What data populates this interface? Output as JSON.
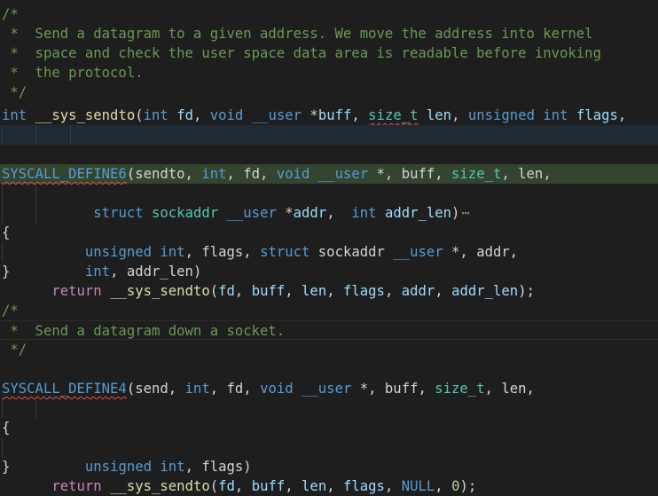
{
  "editor": {
    "language": "C",
    "lines": {
      "l1": [
        {
          "t": "/*",
          "c": "comment"
        }
      ],
      "l2": [
        {
          "t": " *  Send a datagram to a given address. We move the address into kernel",
          "c": "comment"
        }
      ],
      "l3": [
        {
          "t": " *  space and check the user space data area is readable before invoking",
          "c": "comment"
        }
      ],
      "l4": [
        {
          "t": " *  the protocol.",
          "c": "comment"
        }
      ],
      "l5": [
        {
          "t": " */",
          "c": "comment"
        }
      ],
      "l6": [
        {
          "t": "int",
          "c": "kw"
        },
        {
          "t": " ",
          "c": "punc"
        },
        {
          "t": "__sys_sendto",
          "c": "fn"
        },
        {
          "t": "(",
          "c": "punc"
        },
        {
          "t": "int",
          "c": "kw"
        },
        {
          "t": " ",
          "c": "punc"
        },
        {
          "t": "fd",
          "c": "var"
        },
        {
          "t": ", ",
          "c": "punc"
        },
        {
          "t": "void",
          "c": "kw"
        },
        {
          "t": " ",
          "c": "punc"
        },
        {
          "t": "__user",
          "c": "kw"
        },
        {
          "t": " *",
          "c": "punc"
        },
        {
          "t": "buff",
          "c": "var"
        },
        {
          "t": ", ",
          "c": "punc"
        },
        {
          "t": "size_t",
          "c": "type",
          "sq": true
        },
        {
          "t": " ",
          "c": "punc"
        },
        {
          "t": "len",
          "c": "var"
        },
        {
          "t": ", ",
          "c": "punc"
        },
        {
          "t": "unsigned",
          "c": "kw"
        },
        {
          "t": " ",
          "c": "punc"
        },
        {
          "t": "int",
          "c": "kw"
        },
        {
          "t": " ",
          "c": "punc"
        },
        {
          "t": "flags",
          "c": "var"
        },
        {
          "t": ",",
          "c": "punc"
        }
      ],
      "l7": [
        {
          "t": "         ",
          "c": "punc"
        },
        {
          "t": "struct",
          "c": "kw"
        },
        {
          "t": " ",
          "c": "punc"
        },
        {
          "t": "sockaddr",
          "c": "type"
        },
        {
          "t": " ",
          "c": "punc"
        },
        {
          "t": "__user",
          "c": "kw"
        },
        {
          "t": " *",
          "c": "punc"
        },
        {
          "t": "addr",
          "c": "var"
        },
        {
          "t": ",  ",
          "c": "punc"
        },
        {
          "t": "int",
          "c": "kw"
        },
        {
          "t": " ",
          "c": "punc"
        },
        {
          "t": "addr_len",
          "c": "var"
        },
        {
          "t": ")",
          "c": "punc"
        }
      ],
      "l7_fold": "⋯",
      "l8": [],
      "l9": [
        {
          "t": "SYSCALL_DEFINE6",
          "c": "kw",
          "sq": true
        },
        {
          "t": "(sendto, ",
          "c": "punc"
        },
        {
          "t": "int",
          "c": "kw"
        },
        {
          "t": ", fd, ",
          "c": "punc"
        },
        {
          "t": "void",
          "c": "kw"
        },
        {
          "t": " ",
          "c": "punc"
        },
        {
          "t": "__user",
          "c": "kw"
        },
        {
          "t": " *, buff, ",
          "c": "punc"
        },
        {
          "t": "size_t",
          "c": "type"
        },
        {
          "t": ", len,",
          "c": "punc"
        }
      ],
      "l10": [
        {
          "t": "        ",
          "c": "punc"
        },
        {
          "t": "unsigned",
          "c": "kw"
        },
        {
          "t": " ",
          "c": "punc"
        },
        {
          "t": "int",
          "c": "kw"
        },
        {
          "t": ", flags, ",
          "c": "punc"
        },
        {
          "t": "struct",
          "c": "kw"
        },
        {
          "t": " sockaddr ",
          "c": "punc"
        },
        {
          "t": "__user",
          "c": "kw"
        },
        {
          "t": " *, addr,",
          "c": "punc"
        }
      ],
      "l11": [
        {
          "t": "        ",
          "c": "punc"
        },
        {
          "t": "int",
          "c": "kw"
        },
        {
          "t": ", addr_len)",
          "c": "punc"
        }
      ],
      "l12": [
        {
          "t": "{",
          "c": "punc"
        }
      ],
      "l13": [
        {
          "t": "    ",
          "c": "punc"
        },
        {
          "t": "return",
          "c": "ctrl"
        },
        {
          "t": " ",
          "c": "punc"
        },
        {
          "t": "__sys_sendto",
          "c": "fn"
        },
        {
          "t": "(",
          "c": "punc"
        },
        {
          "t": "fd",
          "c": "var"
        },
        {
          "t": ", ",
          "c": "punc"
        },
        {
          "t": "buff",
          "c": "var"
        },
        {
          "t": ", ",
          "c": "punc"
        },
        {
          "t": "len",
          "c": "var"
        },
        {
          "t": ", ",
          "c": "punc"
        },
        {
          "t": "flags",
          "c": "var"
        },
        {
          "t": ", ",
          "c": "punc"
        },
        {
          "t": "addr",
          "c": "var"
        },
        {
          "t": ", ",
          "c": "punc"
        },
        {
          "t": "addr_len",
          "c": "var"
        },
        {
          "t": ");",
          "c": "punc"
        }
      ],
      "l14": [
        {
          "t": "}",
          "c": "punc"
        }
      ],
      "l15": [],
      "l16": [
        {
          "t": "/*",
          "c": "comment"
        }
      ],
      "l17": [
        {
          "t": " *  Send a datagram down a socket.",
          "c": "comment"
        }
      ],
      "l18": [
        {
          "t": " */",
          "c": "comment"
        }
      ],
      "l19": [],
      "l20": [
        {
          "t": "SYSCALL_DEFINE4",
          "c": "kw",
          "sq": true
        },
        {
          "t": "(send, ",
          "c": "punc"
        },
        {
          "t": "int",
          "c": "kw"
        },
        {
          "t": ", fd, ",
          "c": "punc"
        },
        {
          "t": "void",
          "c": "kw"
        },
        {
          "t": " ",
          "c": "punc"
        },
        {
          "t": "__user",
          "c": "kw"
        },
        {
          "t": " *, buff, ",
          "c": "punc"
        },
        {
          "t": "size_t",
          "c": "type"
        },
        {
          "t": ", len,",
          "c": "punc"
        }
      ],
      "l21": [
        {
          "t": "        ",
          "c": "punc"
        },
        {
          "t": "unsigned",
          "c": "kw"
        },
        {
          "t": " ",
          "c": "punc"
        },
        {
          "t": "int",
          "c": "kw"
        },
        {
          "t": ", flags)",
          "c": "punc"
        }
      ],
      "l22": [
        {
          "t": "{",
          "c": "punc"
        }
      ],
      "l23": [
        {
          "t": "    ",
          "c": "punc"
        },
        {
          "t": "return",
          "c": "ctrl"
        },
        {
          "t": " ",
          "c": "punc"
        },
        {
          "t": "__sys_sendto",
          "c": "fn"
        },
        {
          "t": "(",
          "c": "punc"
        },
        {
          "t": "fd",
          "c": "var"
        },
        {
          "t": ", ",
          "c": "punc"
        },
        {
          "t": "buff",
          "c": "var"
        },
        {
          "t": ", ",
          "c": "punc"
        },
        {
          "t": "len",
          "c": "var"
        },
        {
          "t": ", ",
          "c": "punc"
        },
        {
          "t": "flags",
          "c": "var"
        },
        {
          "t": ", ",
          "c": "punc"
        },
        {
          "t": "NULL",
          "c": "kw"
        },
        {
          "t": ", ",
          "c": "punc"
        },
        {
          "t": "0",
          "c": "num"
        },
        {
          "t": ");",
          "c": "punc"
        }
      ],
      "l24": [
        {
          "t": "}",
          "c": "punc"
        }
      ]
    }
  },
  "colors": {
    "background": "#1e1e1e",
    "comment": "#6a9955",
    "keyword": "#569cd6",
    "control": "#c586c0",
    "function": "#dcdcaa",
    "type": "#4ec9b0",
    "variable": "#9cdcfe",
    "number": "#b5cea8",
    "error_squiggle": "#f14c4c",
    "selection_highlight": "#1f2a35",
    "find_highlight": "#34452f"
  }
}
